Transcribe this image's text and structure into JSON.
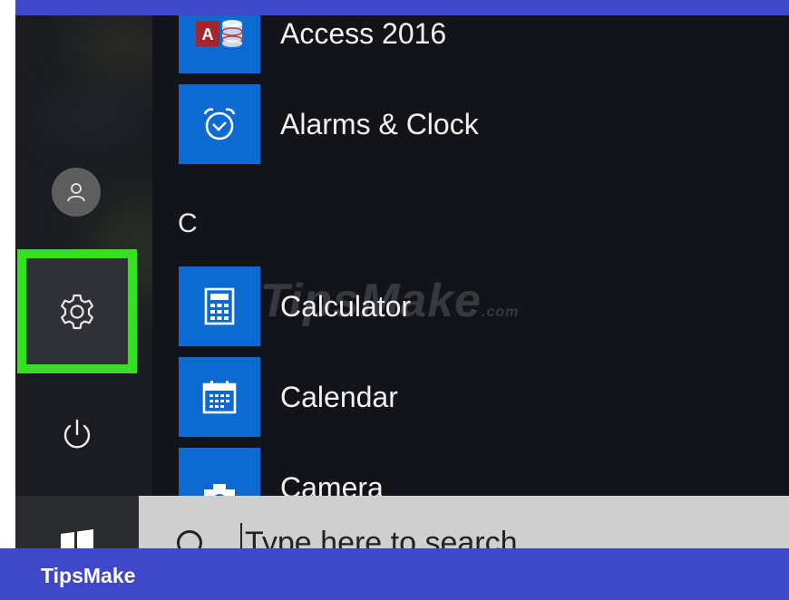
{
  "start_menu": {
    "section_letter": "C",
    "apps": [
      {
        "label": "Access 2016",
        "icon": "access-icon"
      },
      {
        "label": "Alarms & Clock",
        "icon": "alarm-clock-icon"
      },
      {
        "label": "Calculator",
        "icon": "calculator-icon"
      },
      {
        "label": "Calendar",
        "icon": "calendar-icon"
      },
      {
        "label": "Camera",
        "icon": "camera-icon"
      }
    ],
    "rail_icons": [
      "user-icon",
      "gear-icon",
      "power-icon"
    ],
    "access_icon_text": "A"
  },
  "taskbar": {
    "search_placeholder": "Type here to search"
  },
  "watermark": {
    "text": "TipsMake",
    "suffix": ".com"
  },
  "brand": {
    "name": "TipsMake"
  },
  "colors": {
    "tile_blue": "#0c6ad0",
    "highlight_green": "#35e11e",
    "frame_blue": "#3f48c8"
  }
}
